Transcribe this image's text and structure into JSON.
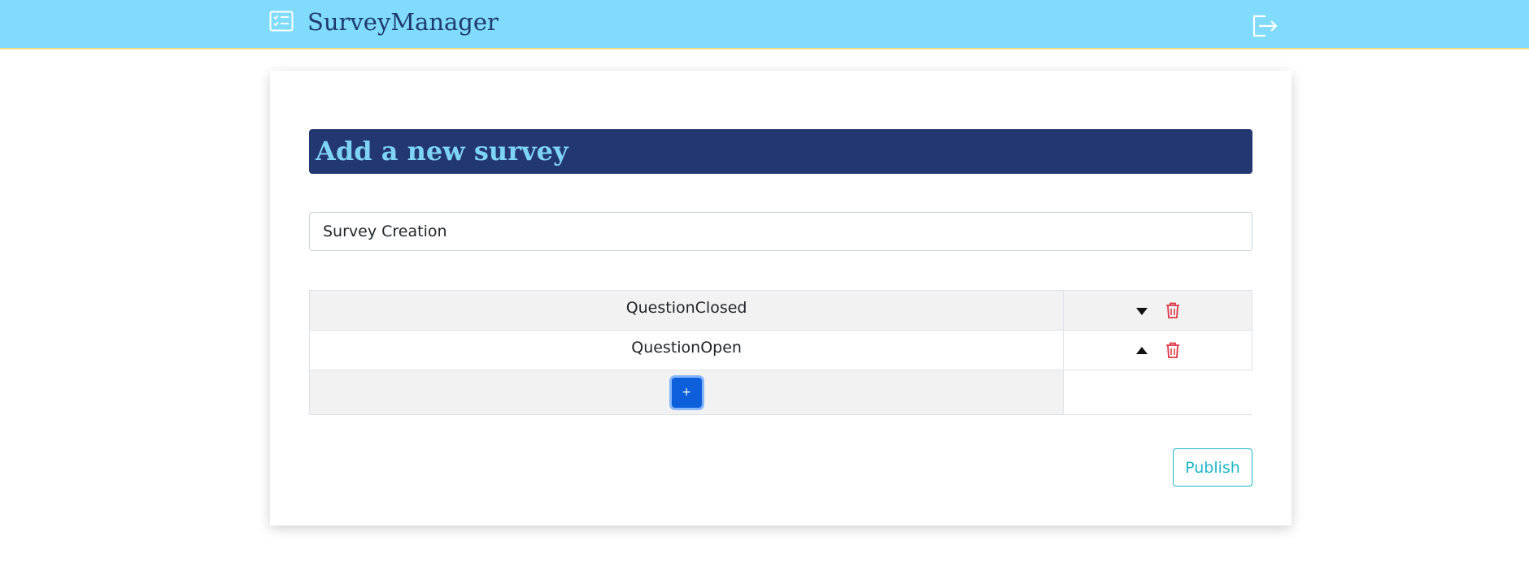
{
  "header": {
    "brand": "SurveyManager",
    "brand_icon": "list-check-icon",
    "logout_icon": "logout-icon",
    "background_color": "#80dbfc"
  },
  "form": {
    "title": "Add a new survey",
    "survey_name_value": "Survey Creation",
    "questions": [
      {
        "label": "QuestionClosed",
        "move_icon": "caret-down-icon"
      },
      {
        "label": "QuestionOpen",
        "move_icon": "caret-up-icon"
      }
    ],
    "add_question_label": "+",
    "publish_label": "Publish"
  },
  "colors": {
    "title_bar": "#233771",
    "title_text": "#7fd4f5",
    "delete": "#dc3545",
    "add_button": "#0d5fdb",
    "publish": "#1fb5c9"
  }
}
